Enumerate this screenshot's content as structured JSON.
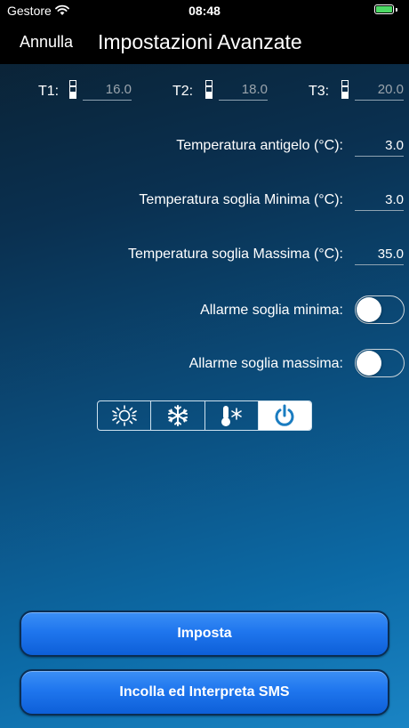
{
  "status": {
    "carrier": "Gestore",
    "time": "08:48"
  },
  "nav": {
    "cancel_label": "Annulla",
    "title": "Impostazioni Avanzate"
  },
  "temps": [
    {
      "label": "T1:",
      "value": "16.0"
    },
    {
      "label": "T2:",
      "value": "18.0"
    },
    {
      "label": "T3:",
      "value": "20.0"
    }
  ],
  "rows": {
    "antifreeze": {
      "label": "Temperatura antigelo (°C):",
      "value": "3.0"
    },
    "min_threshold": {
      "label": "Temperatura soglia Minima (°C):",
      "value": "3.0"
    },
    "max_threshold": {
      "label": "Temperatura soglia Massima (°C):",
      "value": "35.0"
    }
  },
  "toggles": {
    "min_alarm": {
      "label": "Allarme soglia minima:",
      "on": false
    },
    "max_alarm": {
      "label": "Allarme soglia massima:",
      "on": false
    }
  },
  "modes": {
    "items": [
      "sun-icon",
      "snowflake-icon",
      "thermometer-snowflake-icon",
      "power-icon"
    ],
    "selected_index": 3
  },
  "buttons": {
    "set_label": "Imposta",
    "paste_label": "Incolla ed Interpreta SMS"
  },
  "colors": {
    "accent": "#1f76ee",
    "power_icon": "#1a7cc0",
    "toggle_on": "#4cd964"
  }
}
